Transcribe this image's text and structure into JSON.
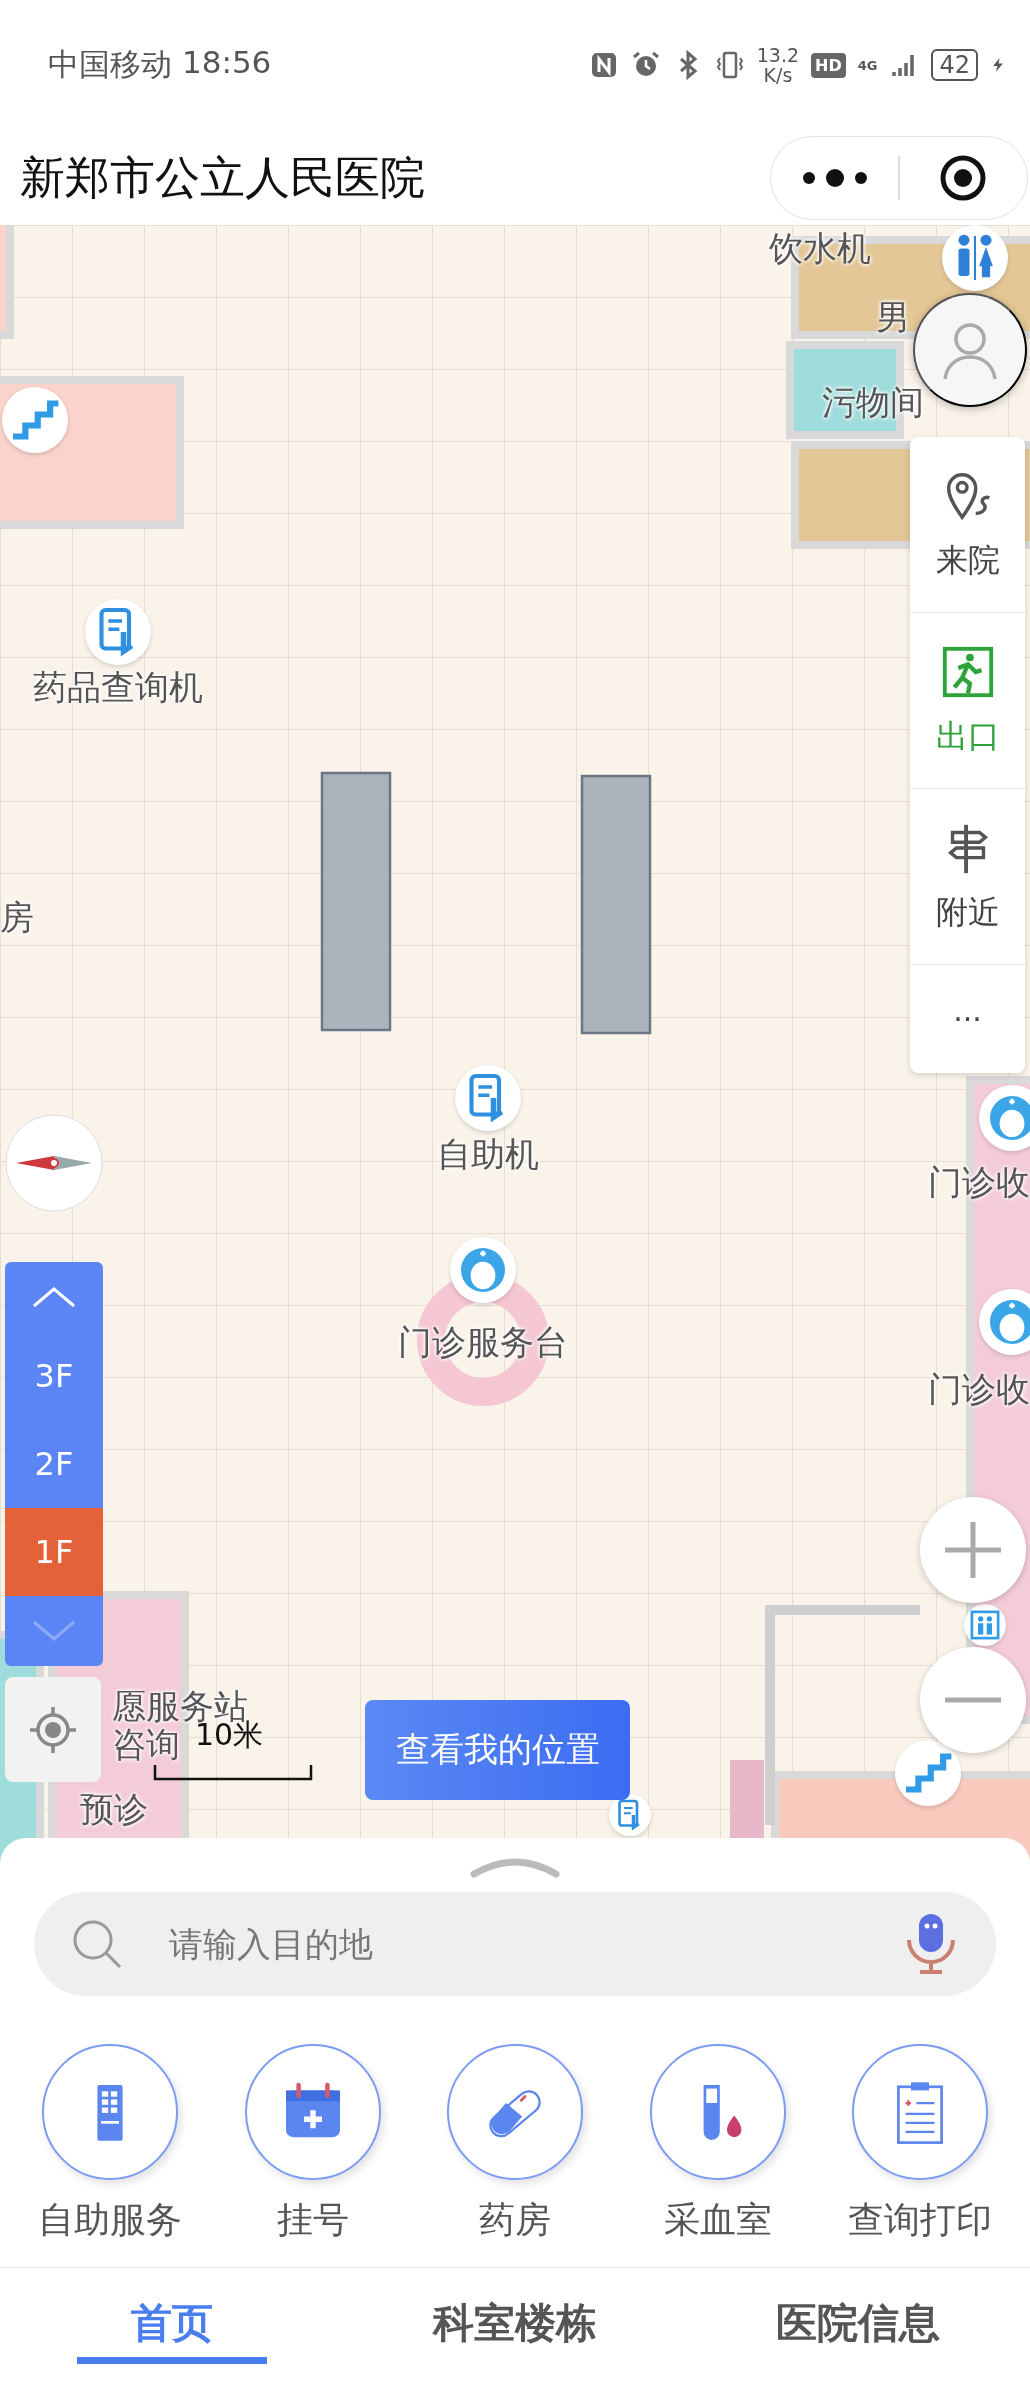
{
  "status_bar": {
    "carrier": "中国移动",
    "time": "18:56",
    "net_speed": "13.2",
    "net_unit": "K/s",
    "hd": "HD",
    "network": "4G",
    "battery": "42"
  },
  "header": {
    "title": "新郑市公立人民医院"
  },
  "map": {
    "places": [
      {
        "label": "饮水机",
        "kind": "none"
      },
      {
        "label": "男",
        "kind": "none"
      },
      {
        "label": "污物间",
        "kind": "none"
      },
      {
        "label": "药品查询机",
        "kind": "kiosk"
      },
      {
        "label": "房",
        "kind": "none"
      },
      {
        "label": "自助机",
        "kind": "kiosk"
      },
      {
        "label": "门诊服务台",
        "kind": "nurse"
      },
      {
        "label": "门诊收",
        "kind": "nurse"
      },
      {
        "label": "门诊收",
        "kind": "nurse"
      },
      {
        "label": "愿服务站",
        "kind": "none"
      },
      {
        "label": "咨询",
        "kind": "none"
      },
      {
        "label": "预诊",
        "kind": "none"
      }
    ],
    "markers": [
      {
        "kind": "stairs"
      },
      {
        "kind": "toilet"
      },
      {
        "kind": "elevator"
      },
      {
        "kind": "stairs"
      },
      {
        "kind": "kiosk"
      }
    ],
    "floors": [
      {
        "label": "3F",
        "selected": false
      },
      {
        "label": "2F",
        "selected": false
      },
      {
        "label": "1F",
        "selected": true
      }
    ],
    "tools": [
      {
        "label": "来院",
        "kind": "arrive"
      },
      {
        "label": "出口",
        "kind": "exit"
      },
      {
        "label": "附近",
        "kind": "nearby"
      },
      {
        "label": "···",
        "kind": "more"
      }
    ],
    "scale": "10米",
    "locate_button": "查看我的位置"
  },
  "search": {
    "placeholder": "请输入目的地"
  },
  "shortcuts": [
    {
      "label": "自助服务",
      "kind": "kiosk"
    },
    {
      "label": "挂号",
      "kind": "register"
    },
    {
      "label": "药房",
      "kind": "pill"
    },
    {
      "label": "采血室",
      "kind": "blood"
    },
    {
      "label": "查询打印",
      "kind": "report"
    }
  ],
  "tabs": [
    {
      "label": "首页",
      "selected": true
    },
    {
      "label": "科室楼栋",
      "selected": false
    },
    {
      "label": "医院信息",
      "selected": false
    }
  ]
}
